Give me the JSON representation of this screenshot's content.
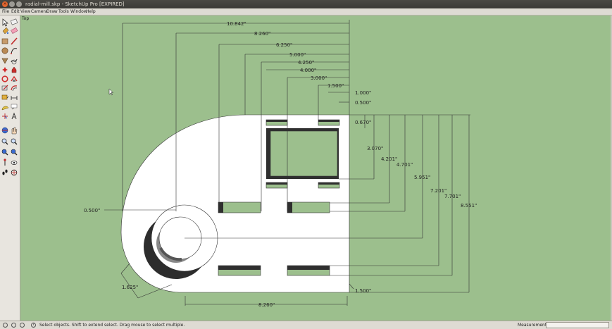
{
  "window": {
    "title": "radial-mill.skp - SketchUp Pro [EXPIRED]"
  },
  "menu": [
    "File",
    "Edit",
    "View",
    "Camera",
    "Draw",
    "Tools",
    "Window",
    "Help"
  ],
  "viewport": {
    "label": "Top",
    "background": "#9cbf8d"
  },
  "dimensions": {
    "h1": "10.842\"",
    "h2": "8.260\"",
    "h3": "6.250\"",
    "h4": "5.000\"",
    "h5": "4.250\"",
    "h6": "4.000\"",
    "h7": "3.000\"",
    "h8": "1.500\"",
    "h9": "1.000\"",
    "h10": "0.500\"",
    "v1": "0.670\"",
    "v2": "3.070\"",
    "v3": "4.201\"",
    "v4": "4.701\"",
    "v5": "5.951\"",
    "v6": "7.201\"",
    "v7": "7.701\"",
    "v8": "8.551\"",
    "left_radius": "0.500\"",
    "chamfer": "1.625\"",
    "bottom_width": "8.260\"",
    "bottom_right": "1.500\""
  },
  "tools": [
    "select-tool",
    "eraser-tool",
    "paint-bucket-tool",
    "eraser-pink-tool",
    "rectangle-tool",
    "line-tool",
    "circle-tool",
    "arc-tool",
    "polygon-tool",
    "freehand-tool",
    "move-tool",
    "push-pull-tool",
    "rotate-tool",
    "follow-me-tool",
    "scale-tool",
    "offset-tool",
    "tape-measure-tool",
    "dimension-tool",
    "protractor-tool",
    "text-tool",
    "axes-tool",
    "3d-text-tool",
    "orbit-tool",
    "pan-tool",
    "zoom-tool",
    "zoom-window-tool",
    "zoom-extents-tool",
    "previous-view-tool",
    "position-camera-tool",
    "look-around-tool",
    "walk-tool",
    "section-plane-tool"
  ],
  "status": {
    "text": "Select objects. Shift to extend select. Drag mouse to select multiple.",
    "measurements_label": "Measurements",
    "measurements_value": ""
  }
}
